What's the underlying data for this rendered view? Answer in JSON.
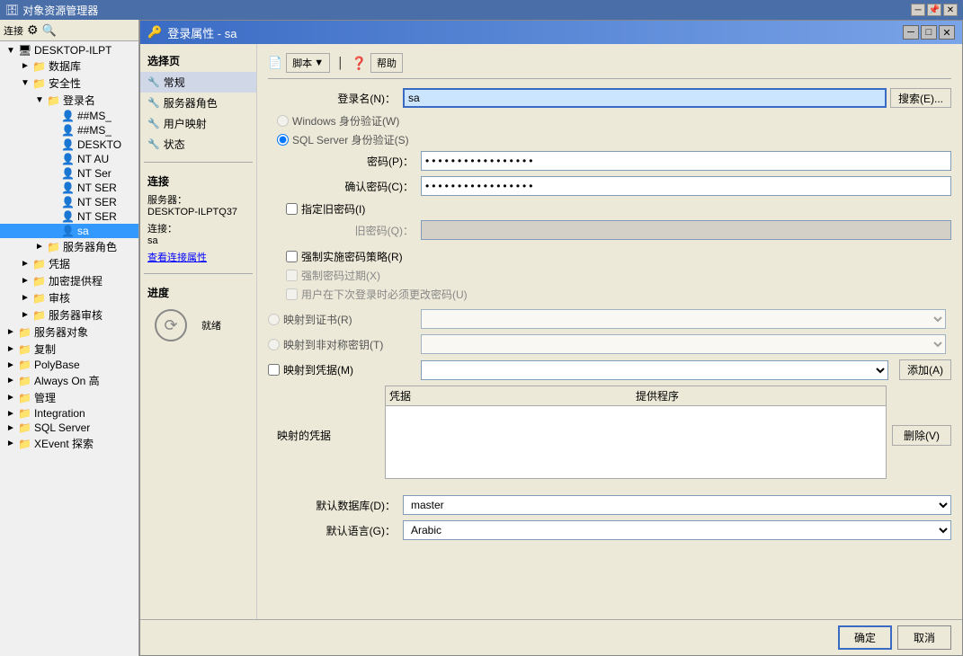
{
  "outerWindow": {
    "title": "对象资源管理器",
    "titleBtns": [
      "─",
      "□",
      "✕"
    ]
  },
  "leftPanel": {
    "title": "对象资源管理器",
    "toolbarBtns": [
      "连接",
      "⚙",
      "✕"
    ],
    "tree": [
      {
        "id": "root",
        "label": "DESKTOP-ILPT",
        "indent": 0,
        "icon": "🖥",
        "expanded": true
      },
      {
        "id": "db",
        "label": "数据库",
        "indent": 1,
        "icon": "📁",
        "expanded": false
      },
      {
        "id": "security",
        "label": "安全性",
        "indent": 1,
        "icon": "📁",
        "expanded": true
      },
      {
        "id": "logins",
        "label": "登录名",
        "indent": 2,
        "icon": "📁",
        "expanded": true
      },
      {
        "id": "login1",
        "label": "##MS_",
        "indent": 3,
        "icon": "👤"
      },
      {
        "id": "login2",
        "label": "##MS_",
        "indent": 3,
        "icon": "👤"
      },
      {
        "id": "login3",
        "label": "DESKTO",
        "indent": 3,
        "icon": "👤"
      },
      {
        "id": "login4",
        "label": "NT AU",
        "indent": 3,
        "icon": "👤"
      },
      {
        "id": "login5",
        "label": "NT Ser",
        "indent": 3,
        "icon": "👤"
      },
      {
        "id": "login6",
        "label": "NT SER",
        "indent": 3,
        "icon": "👤"
      },
      {
        "id": "login7",
        "label": "NT SER",
        "indent": 3,
        "icon": "👤"
      },
      {
        "id": "login8",
        "label": "NT SER",
        "indent": 3,
        "icon": "👤"
      },
      {
        "id": "login9",
        "label": "sa",
        "indent": 3,
        "icon": "👤",
        "selected": true
      },
      {
        "id": "serverroles",
        "label": "服务器角色",
        "indent": 2,
        "icon": "📁"
      },
      {
        "id": "credentials",
        "label": "凭据",
        "indent": 1,
        "icon": "📁"
      },
      {
        "id": "cryptoproviders",
        "label": "加密提供程",
        "indent": 1,
        "icon": "📁"
      },
      {
        "id": "audit",
        "label": "审核",
        "indent": 1,
        "icon": "📁"
      },
      {
        "id": "serveraudit",
        "label": "服务器审核",
        "indent": 1,
        "icon": "📁"
      },
      {
        "id": "serverobj",
        "label": "服务器对象",
        "indent": 0,
        "icon": "📁"
      },
      {
        "id": "replication",
        "label": "复制",
        "indent": 0,
        "icon": "📁"
      },
      {
        "id": "polybase",
        "label": "PolyBase",
        "indent": 0,
        "icon": "📁"
      },
      {
        "id": "alwayson",
        "label": "Always On 高",
        "indent": 0,
        "icon": "📁"
      },
      {
        "id": "management",
        "label": "管理",
        "indent": 0,
        "icon": "📁"
      },
      {
        "id": "integration",
        "label": "Integration",
        "indent": 0,
        "icon": "📁"
      },
      {
        "id": "sqlserver",
        "label": "SQL Server",
        "indent": 0,
        "icon": "📁"
      },
      {
        "id": "xevent",
        "label": "XEvent 探索",
        "indent": 0,
        "icon": "📁"
      }
    ]
  },
  "dialog": {
    "title": "登录属性 - sa",
    "icon": "🔑",
    "titleBtns": [
      "─",
      "□",
      "✕"
    ],
    "toolbar": {
      "scriptLabel": "脚本",
      "helpLabel": "帮助"
    },
    "nav": {
      "selectPageLabel": "选择页",
      "items": [
        {
          "label": "常规",
          "icon": "🔧"
        },
        {
          "label": "服务器角色",
          "icon": "🔧"
        },
        {
          "label": "用户映射",
          "icon": "🔧"
        },
        {
          "label": "状态",
          "icon": "🔧"
        }
      ],
      "connectSection": "连接",
      "serverLabel": "服务器：",
      "serverValue": "DESKTOP-ILPTQ37",
      "connectionLabel": "连接：",
      "connectionValue": "sa",
      "viewConnectionLabel": "查看连接属性",
      "progressSection": "进度",
      "progressStatus": "就绪"
    },
    "content": {
      "loginNameLabel": "登录名(N)：",
      "loginNameValue": "sa",
      "searchLabel": "搜索(E)...",
      "windowsAuthLabel": "Windows 身份验证(W)",
      "sqlAuthLabel": "SQL Server 身份验证(S)",
      "passwordLabel": "密码(P)：",
      "passwordValue": "●●●●●●●●●●●●●●●●●",
      "confirmPwdLabel": "确认密码(C)：",
      "confirmPwdValue": "●●●●●●●●●●●●●●●●●",
      "specifyOldPwdLabel": "指定旧密码(I)",
      "oldPwdLabel": "旧密码(Q)：",
      "enforcePwdPolicyLabel": "强制实施密码策略(R)",
      "enforcePwdExpiryLabel": "强制密码过期(X)",
      "mustChangePwdLabel": "用户在下次登录时必须更改密码(U)",
      "mapToCertLabel": "映射到证书(R)",
      "mapToAsymKeyLabel": "映射到非对称密钥(T)",
      "mapToCredLabel": "映射到凭据(M)",
      "addCredLabel": "添加(A)",
      "mappedCredLabel": "映射的凭据",
      "credColLabel": "凭据",
      "providerColLabel": "提供程序",
      "deleteLabel": "删除(V)",
      "defaultDbLabel": "默认数据库(D)：",
      "defaultDbValue": "master",
      "defaultLangLabel": "默认语言(G)：",
      "defaultLangValue": "Arabic",
      "okLabel": "确定",
      "cancelLabel": "取消"
    }
  }
}
